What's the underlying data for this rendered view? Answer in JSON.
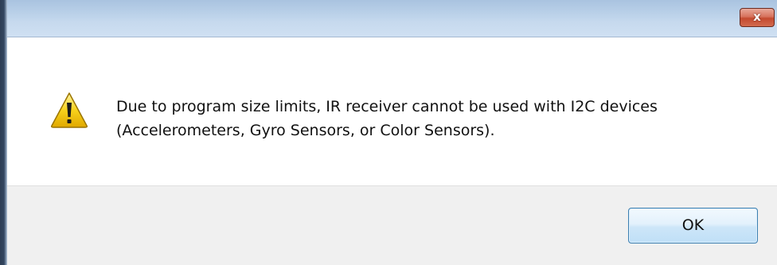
{
  "dialog": {
    "title": "",
    "close_label": "x",
    "icon": "warning-icon",
    "message_lines": [
      "Due to program size limits, IR receiver cannot be used with I2C devices",
      "(Accelerometers, Gyro Sensors, or Color Sensors)."
    ],
    "ok_label": "OK"
  },
  "colors": {
    "titlebar": "#b9d0e8",
    "close_button": "#c44a2f",
    "warning_yellow": "#f7d21c",
    "footer": "#f0f0f0",
    "ok_border": "#3c7fb1"
  }
}
